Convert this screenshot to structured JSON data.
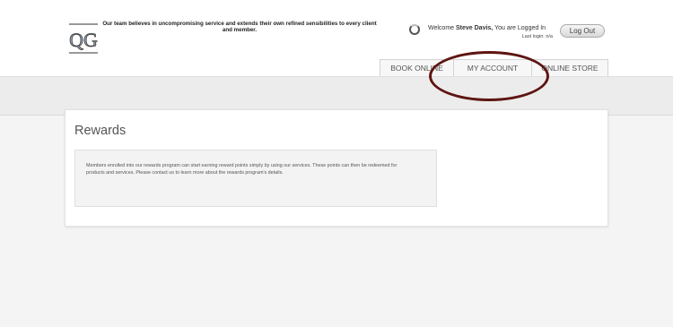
{
  "header": {
    "tagline": "Our team believes in uncompromising service and extends their own refined sensibilities to every client and member.",
    "welcome_prefix": "Welcome",
    "user_name": "Steve Davis,",
    "welcome_suffix": "You are Logged In",
    "last_login": "Last login: n/a",
    "logout_label": "Log Out",
    "logo_icon": "qg-monogram-logo",
    "status_icon": "loading-spinner-icon"
  },
  "nav": {
    "tabs": [
      {
        "label": "BOOK ONLINE"
      },
      {
        "label": "MY ACCOUNT"
      },
      {
        "label": "ONLINE STORE"
      }
    ]
  },
  "main": {
    "title": "Rewards",
    "description": "Members enrolled into our rewards program can start earning reward points simply by using our services. These points can then be redeemed for products and services. Please contact us to learn more about the rewards program's details."
  },
  "colors": {
    "annotation_ring": "#5e1512",
    "background": "#f4f4f4",
    "panel": "#ffffff"
  }
}
